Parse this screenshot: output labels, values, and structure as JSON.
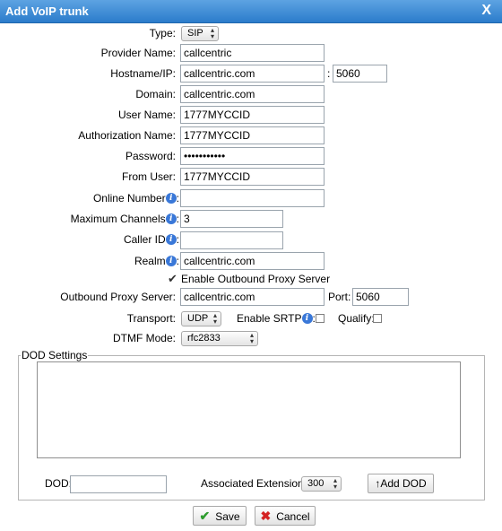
{
  "dialog": {
    "title": "Add VoIP trunk",
    "close_label": "X"
  },
  "form": {
    "type": {
      "label": "Type:",
      "value": "SIP"
    },
    "provider_name": {
      "label": "Provider Name:",
      "value": "callcentric"
    },
    "hostname": {
      "label": "Hostname/IP:",
      "value": "callcentric.com",
      "port_sep": ":",
      "port": "5060"
    },
    "domain": {
      "label": "Domain:",
      "value": "callcentric.com"
    },
    "user_name": {
      "label": "User Name:",
      "value": "1777MYCCID"
    },
    "auth_name": {
      "label": "Authorization Name:",
      "value": "1777MYCCID"
    },
    "password": {
      "label": "Password:",
      "value": "•••••••••••"
    },
    "from_user": {
      "label": "From User:",
      "value": "1777MYCCID"
    },
    "online_number": {
      "label": "Online Number",
      "colon": ":",
      "value": ""
    },
    "max_channels": {
      "label": "Maximum Channels",
      "colon": ":",
      "value": "3"
    },
    "caller_id": {
      "label": "Caller ID",
      "colon": ":",
      "value": ""
    },
    "realm": {
      "label": "Realm",
      "colon": ":",
      "value": "callcentric.com"
    },
    "outbound_proxy_toggle": {
      "label": "Enable Outbound Proxy Server",
      "checked": true
    },
    "outbound_proxy": {
      "label": "Outbound Proxy Server:",
      "value": "callcentric.com",
      "port_label": "Port:",
      "port": "5060"
    },
    "transport": {
      "label": "Transport:",
      "value": "UDP"
    },
    "srtp": {
      "label": "Enable SRTP",
      "colon": ":",
      "checked": false
    },
    "qualify": {
      "label": "Qualify:",
      "checked": false
    },
    "dtmf": {
      "label": "DTMF Mode:",
      "value": "rfc2833"
    }
  },
  "dod": {
    "legend": "DOD Settings",
    "dod_label": "DOD:",
    "dod_value": "",
    "ext_label": "Associated Extension:",
    "ext_value": "300",
    "add_button": "↑Add DOD"
  },
  "buttons": {
    "save": "Save",
    "cancel": "Cancel"
  },
  "icons": {
    "info": "i",
    "check": "✔",
    "save": "✔",
    "cancel": "✖",
    "select_arrows": "▲▼"
  }
}
